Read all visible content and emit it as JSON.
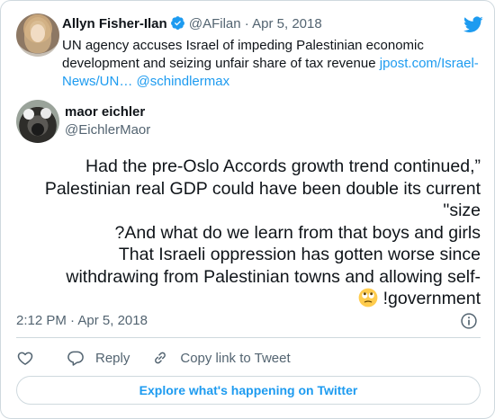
{
  "quoted_tweet": {
    "name": "Allyn Fisher-Ilan",
    "handle": "@AFilan",
    "separator": "·",
    "date": "Apr 5, 2018",
    "text": "UN agency accuses Israel of impeding Palestinian economic development and seizing unfair share of tax revenue ",
    "link_url": "jpost.com/Israel-News/UN…",
    "mention": "@schindlermax"
  },
  "tweet": {
    "author_name": "maor eichler",
    "author_handle": "@EichlerMaor",
    "lines": [
      "Had the pre-Oslo Accords growth trend continued,”",
      "Palestinian real GDP could have been double its current",
      "\"size",
      "?And what do we learn from that boys and girls",
      "That Israeli oppression has gotten worse since",
      "withdrawing from Palestinian towns and allowing self-",
      "!government"
    ],
    "emoji": "face-with-rolling-eyes",
    "time": "2:12 PM",
    "separator": "·",
    "date": "Apr 5, 2018"
  },
  "actions": {
    "reply_label": "Reply",
    "copy_label": "Copy link to Tweet"
  },
  "explore_label": "Explore what's happening on Twitter",
  "icons": {
    "brand": "twitter-bird-icon",
    "verified": "verified-badge-icon",
    "info": "info-icon",
    "like": "heart-icon",
    "reply": "reply-bubble-icon",
    "copy": "link-icon"
  },
  "colors": {
    "accent": "#1d9bf0",
    "secondary_text": "#536471",
    "primary_text": "#0f1419",
    "border": "#cfd9de"
  }
}
